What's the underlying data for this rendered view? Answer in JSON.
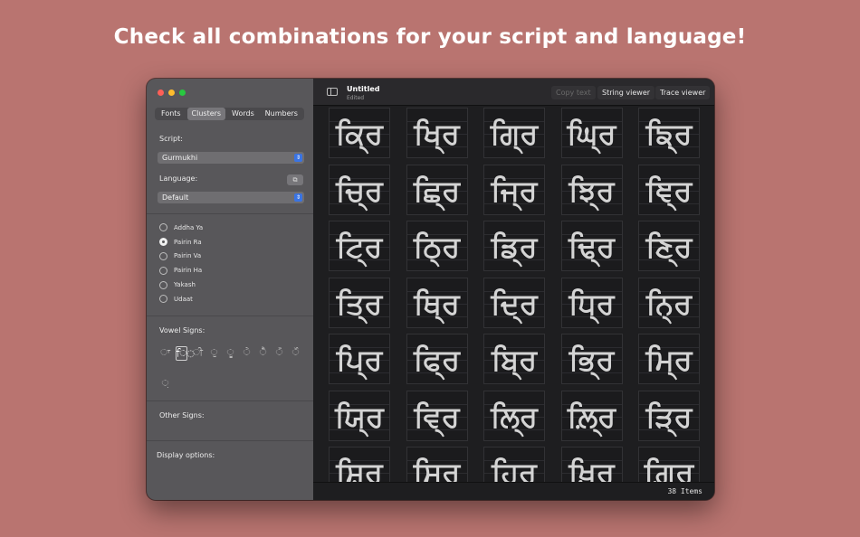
{
  "headline": "Check all combinations for your script and language!",
  "window": {
    "title": "Untitled",
    "subtitle": "Edited",
    "toolbar": {
      "copy_text": "Copy text",
      "string_viewer": "String viewer",
      "trace_viewer": "Trace viewer"
    },
    "status": "38 Items"
  },
  "sidebar": {
    "tabs": [
      "Fonts",
      "Clusters",
      "Words",
      "Numbers"
    ],
    "active_tab": "Clusters",
    "script_label": "Script:",
    "script_value": "Gurmukhi",
    "language_label": "Language:",
    "language_value": "Default",
    "clusters": [
      {
        "label": "Addha Ya",
        "checked": false
      },
      {
        "label": "Pairin Ra",
        "checked": true
      },
      {
        "label": "Pairin Va",
        "checked": false
      },
      {
        "label": "Pairin Ha",
        "checked": false
      },
      {
        "label": "Yakash",
        "checked": false
      },
      {
        "label": "Udaat",
        "checked": false
      }
    ],
    "vowel_signs_label": "Vowel Signs:",
    "vowel_signs": [
      "◌ਾ",
      "ਿ◌",
      "◌ੀ",
      "◌ੁ",
      "◌ੂ",
      "◌ੇ",
      "◌ੈ",
      "◌ੋ",
      "◌ੌ",
      "◌਼"
    ],
    "selected_vowel": 1,
    "other_signs_label": "Other Signs:",
    "display_options_label": "Display options:"
  },
  "grid": {
    "glyphs": [
      "ਕ੍ਰਿ",
      "ਖ੍ਰਿ",
      "ਗ੍ਰਿ",
      "ਘ੍ਰਿ",
      "ਙ੍ਰਿ",
      "ਚ੍ਰਿ",
      "ਛ੍ਰਿ",
      "ਜ੍ਰਿ",
      "ਝ੍ਰਿ",
      "ਞ੍ਰਿ",
      "ਟ੍ਰਿ",
      "ਠ੍ਰਿ",
      "ਡ੍ਰਿ",
      "ਢ੍ਰਿ",
      "ਣ੍ਰਿ",
      "ਤ੍ਰਿ",
      "ਥ੍ਰਿ",
      "ਦ੍ਰਿ",
      "ਧ੍ਰਿ",
      "ਨ੍ਰਿ",
      "ਪ੍ਰਿ",
      "ਫ੍ਰਿ",
      "ਬ੍ਰਿ",
      "ਭ੍ਰਿ",
      "ਮ੍ਰਿ",
      "ਯ੍ਰਿ",
      "ਵ੍ਰਿ",
      "ਲ੍ਰਿ",
      "ਲ਼੍ਰਿ",
      "ੜ੍ਰਿ",
      "ਸ਼੍ਰਿ",
      "ਸ੍ਰਿ",
      "ਹ੍ਰਿ",
      "ਖ਼੍ਰਿ",
      "ਗ਼੍ਰਿ"
    ]
  }
}
